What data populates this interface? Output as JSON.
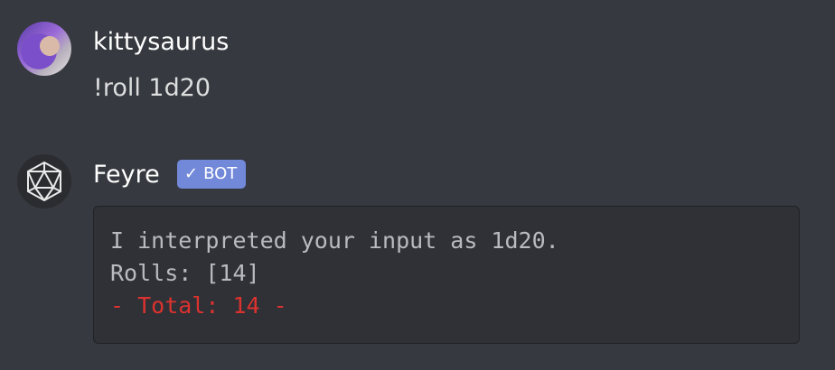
{
  "messages": [
    {
      "author": "kittysaurus",
      "avatar": "user-avatar",
      "text": "!roll 1d20"
    },
    {
      "author": "Feyre",
      "avatar": "d20-icon",
      "badge": {
        "icon": "check-icon",
        "label": "BOT",
        "color": "#7289da"
      },
      "code_lines": [
        "I interpreted your input as 1d20.",
        "Rolls: [14]",
        "- Total: 14 -"
      ],
      "total_color": "#dc322f"
    }
  ]
}
